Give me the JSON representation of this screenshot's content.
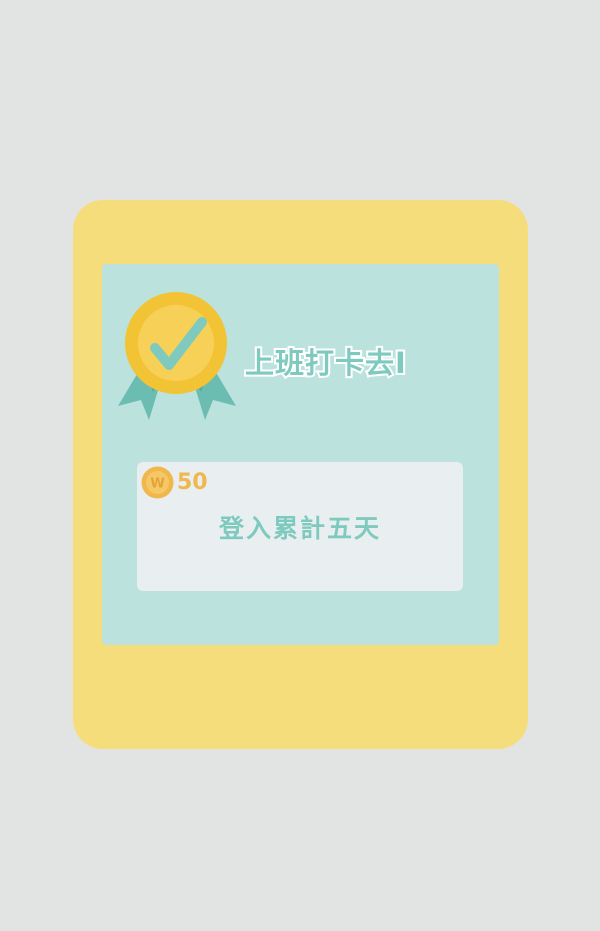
{
  "achievement": {
    "title": "上班打卡去I",
    "reward": {
      "amount": "50",
      "coin_letter": "W"
    },
    "task_label": "登入累計五天"
  },
  "colors": {
    "background": "#e2e3e3",
    "card": "#f6dd7c",
    "panel": "#bbe2dd",
    "task_box": "#e9eef0",
    "accent": "#7fcabf",
    "coin": "#f0b74c"
  },
  "icons": {
    "medal": "medal-check-icon",
    "coin": "coin-icon"
  }
}
